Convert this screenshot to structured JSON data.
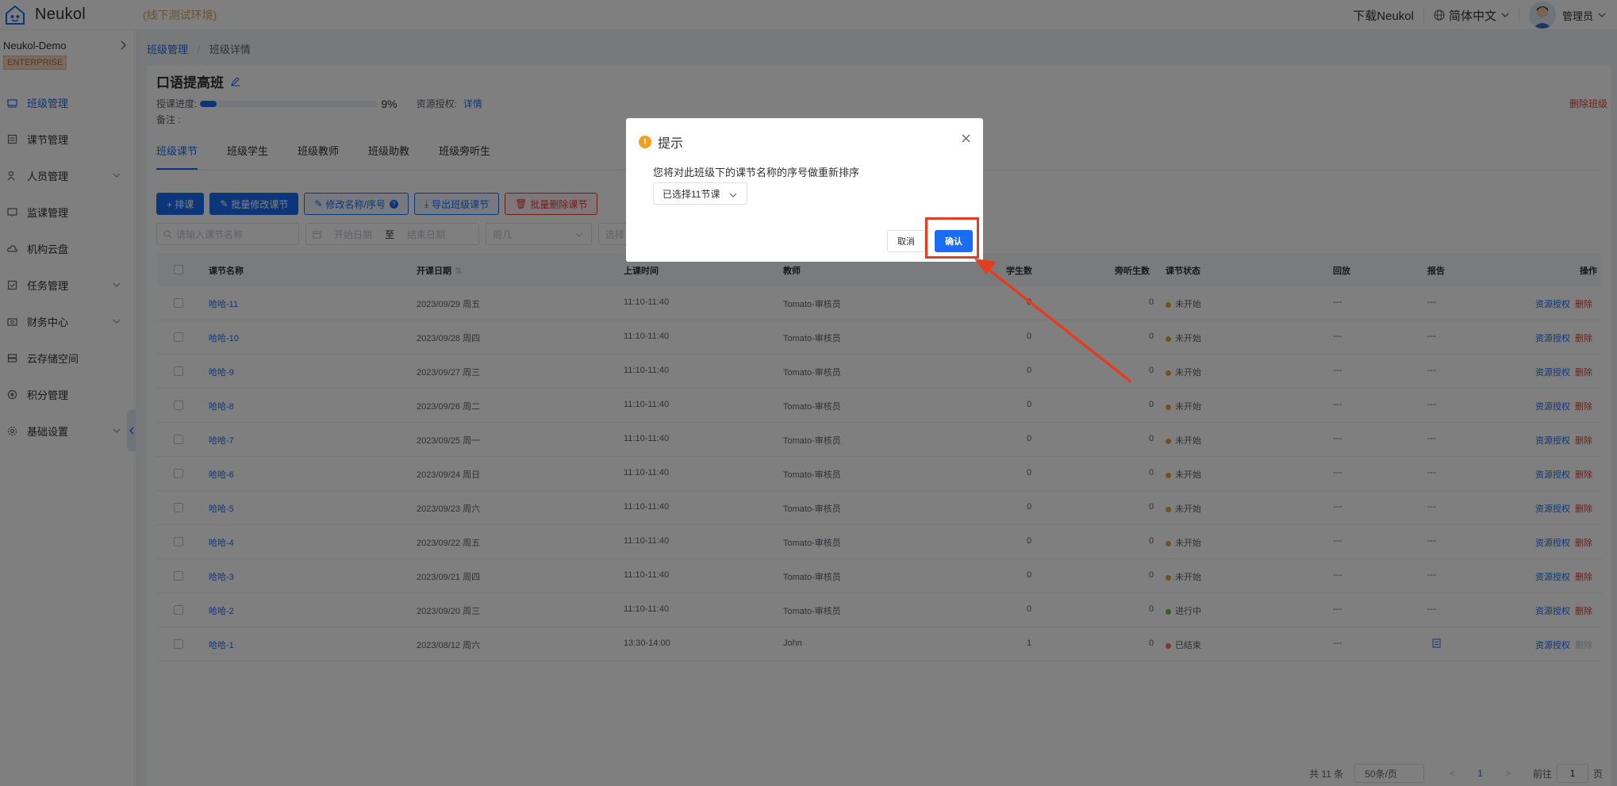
{
  "header": {
    "brand": "Neukol",
    "env_tag": "(线下测试环境)",
    "download": "下载Neukol",
    "language": "简体中文",
    "user": "管理员"
  },
  "sidebar": {
    "org_name": "Neukol-Demo",
    "org_badge": "ENTERPRISE",
    "items": [
      {
        "label": "班级管理",
        "icon": "class-icon",
        "active": true,
        "has_children": false
      },
      {
        "label": "课节管理",
        "icon": "lesson-icon",
        "active": false,
        "has_children": false
      },
      {
        "label": "人员管理",
        "icon": "people-icon",
        "active": false,
        "has_children": true
      },
      {
        "label": "监课管理",
        "icon": "monitor-icon",
        "active": false,
        "has_children": false
      },
      {
        "label": "机构云盘",
        "icon": "cloud-icon",
        "active": false,
        "has_children": false
      },
      {
        "label": "任务管理",
        "icon": "task-icon",
        "active": false,
        "has_children": true
      },
      {
        "label": "财务中心",
        "icon": "finance-icon",
        "active": false,
        "has_children": true
      },
      {
        "label": "云存储空间",
        "icon": "storage-icon",
        "active": false,
        "has_children": false
      },
      {
        "label": "积分管理",
        "icon": "points-icon",
        "active": false,
        "has_children": false
      },
      {
        "label": "基础设置",
        "icon": "settings-icon",
        "active": false,
        "has_children": true
      }
    ]
  },
  "breadcrumb": {
    "parent": "班级管理",
    "sep": "/",
    "current": "班级详情"
  },
  "class_info": {
    "title": "口语提高班",
    "progress_label": "授课进度:",
    "progress_value": 9,
    "progress_text": "9%",
    "resource_label": "资源授权:",
    "resource_link": "详情",
    "note_label": "备注 :",
    "delete_label": "删除班级"
  },
  "tabs": [
    "班级课节",
    "班级学生",
    "班级教师",
    "班级助教",
    "班级旁听生"
  ],
  "toolbar": {
    "schedule": "+ 排课",
    "batch_edit": "批量修改课节",
    "rename": "修改名称/序号",
    "export": "导出班级课节",
    "batch_delete": "批量删除课节"
  },
  "filters": {
    "name_placeholder": "请输入课节名称",
    "start_placeholder": "开始日期",
    "to": "至",
    "end_placeholder": "结束日期",
    "weekday_placeholder": "周几",
    "select_placeholder": "选择"
  },
  "table": {
    "headers": {
      "name": "课节名称",
      "date": "开课日期",
      "time": "上课时间",
      "teacher": "教师",
      "students": "学生数",
      "auditors": "旁听生数",
      "status": "课节状态",
      "playback": "回放",
      "report": "报告",
      "ops": "操作"
    },
    "rows": [
      {
        "name": "哈哈-11",
        "date": "2023/09/29 周五",
        "time": "11:10-11:40",
        "teacher": "Tomato-审核员",
        "students": "0",
        "auditors": "0",
        "status": "未开始",
        "status_color": "#e6a23c",
        "playback": "---",
        "report": "---",
        "op_auth": "资源授权",
        "op_del": "删除"
      },
      {
        "name": "哈哈-10",
        "date": "2023/09/28 周四",
        "time": "11:10-11:40",
        "teacher": "Tomato-审核员",
        "students": "0",
        "auditors": "0",
        "status": "未开始",
        "status_color": "#e6a23c",
        "playback": "---",
        "report": "---",
        "op_auth": "资源授权",
        "op_del": "删除"
      },
      {
        "name": "哈哈-9",
        "date": "2023/09/27 周三",
        "time": "11:10-11:40",
        "teacher": "Tomato-审核员",
        "students": "0",
        "auditors": "0",
        "status": "未开始",
        "status_color": "#e6a23c",
        "playback": "---",
        "report": "---",
        "op_auth": "资源授权",
        "op_del": "删除"
      },
      {
        "name": "哈哈-8",
        "date": "2023/09/26 周二",
        "time": "11:10-11:40",
        "teacher": "Tomato-审核员",
        "students": "0",
        "auditors": "0",
        "status": "未开始",
        "status_color": "#e6a23c",
        "playback": "---",
        "report": "---",
        "op_auth": "资源授权",
        "op_del": "删除"
      },
      {
        "name": "哈哈-7",
        "date": "2023/09/25 周一",
        "time": "11:10-11:40",
        "teacher": "Tomato-审核员",
        "students": "0",
        "auditors": "0",
        "status": "未开始",
        "status_color": "#e6a23c",
        "playback": "---",
        "report": "---",
        "op_auth": "资源授权",
        "op_del": "删除"
      },
      {
        "name": "哈哈-6",
        "date": "2023/09/24 周日",
        "time": "11:10-11:40",
        "teacher": "Tomato-审核员",
        "students": "0",
        "auditors": "0",
        "status": "未开始",
        "status_color": "#e6a23c",
        "playback": "---",
        "report": "---",
        "op_auth": "资源授权",
        "op_del": "删除"
      },
      {
        "name": "哈哈-5",
        "date": "2023/09/23 周六",
        "time": "11:10-11:40",
        "teacher": "Tomato-审核员",
        "students": "0",
        "auditors": "0",
        "status": "未开始",
        "status_color": "#e6a23c",
        "playback": "---",
        "report": "---",
        "op_auth": "资源授权",
        "op_del": "删除"
      },
      {
        "name": "哈哈-4",
        "date": "2023/09/22 周五",
        "time": "11:10-11:40",
        "teacher": "Tomato-审核员",
        "students": "0",
        "auditors": "0",
        "status": "未开始",
        "status_color": "#e6a23c",
        "playback": "---",
        "report": "---",
        "op_auth": "资源授权",
        "op_del": "删除"
      },
      {
        "name": "哈哈-3",
        "date": "2023/09/21 周四",
        "time": "11:10-11:40",
        "teacher": "Tomato-审核员",
        "students": "0",
        "auditors": "0",
        "status": "未开始",
        "status_color": "#e6a23c",
        "playback": "---",
        "report": "---",
        "op_auth": "资源授权",
        "op_del": "删除"
      },
      {
        "name": "哈哈-2",
        "date": "2023/09/20 周三",
        "time": "11:10-11:40",
        "teacher": "Tomato-审核员",
        "students": "0",
        "auditors": "0",
        "status": "进行中",
        "status_color": "#67c23a",
        "playback": "---",
        "report": "---",
        "op_auth": "资源授权",
        "op_del": "删除"
      },
      {
        "name": "哈哈-1",
        "date": "2023/08/12 周六",
        "time": "13:30-14:00",
        "teacher": "John",
        "students": "1",
        "auditors": "0",
        "status": "已结束",
        "status_color": "#f56c6c",
        "playback": "---",
        "report": "report-doc-icon",
        "op_auth": "资源授权",
        "op_del": "删除",
        "op_del_disabled": true
      }
    ]
  },
  "pagination": {
    "total": "共 11 条",
    "page_size": "50条/页",
    "prev": "<",
    "current": "1",
    "next": ">",
    "goto_label": "前往",
    "goto_value": "1",
    "goto_suffix": "页"
  },
  "dialog": {
    "title": "提示",
    "message": "您将对此班级下的课节名称的序号做重新排序",
    "select_value": "已选择11节课",
    "cancel": "取消",
    "confirm": "确认"
  },
  "annotation": {
    "color": "#e23d1e"
  }
}
